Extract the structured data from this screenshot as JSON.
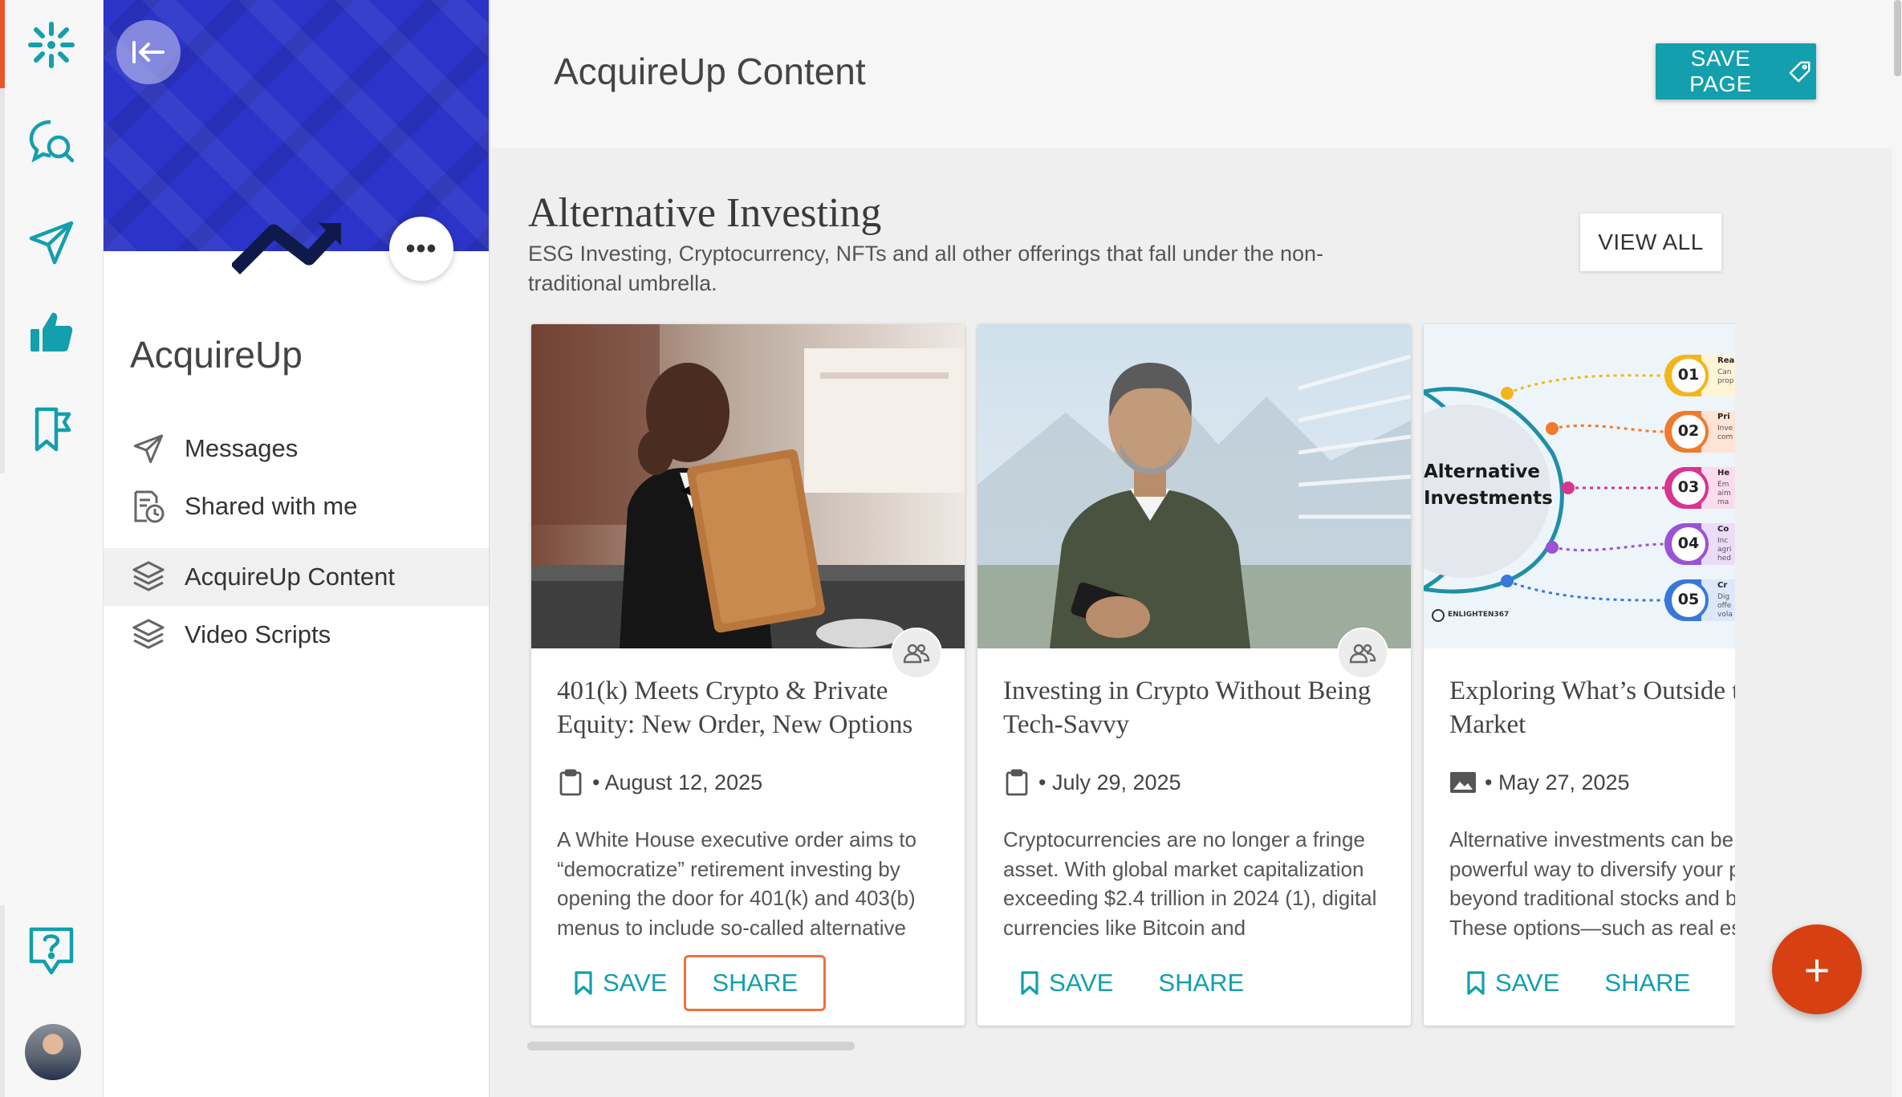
{
  "app": {
    "page_title": "AcquireUp Content",
    "save_page_label": "SAVE PAGE",
    "accent_color": "#139fad",
    "brand_orange": "#e8562a"
  },
  "rail": {
    "icons": [
      "brand-spark-icon",
      "search-chat-icon",
      "paper-plane-icon",
      "thumbs-up-icon",
      "bookmark-flag-icon",
      "help-chat-icon",
      "user-avatar"
    ]
  },
  "panel": {
    "org_name": "AcquireUp",
    "nav": [
      {
        "label": "Messages",
        "icon": "paper-plane-icon"
      },
      {
        "label": "Shared with me",
        "icon": "shared-doc-icon"
      },
      {
        "label": "AcquireUp Content",
        "icon": "layers-icon",
        "active": true
      },
      {
        "label": "Video Scripts",
        "icon": "layers-icon"
      }
    ]
  },
  "section": {
    "title": "Alternative Investing",
    "description": "ESG Investing, Cryptocurrency, NFTs and all other offerings that fall under the non-traditional umbrella.",
    "view_all_label": "VIEW ALL"
  },
  "cards": [
    {
      "title": "401(k) Meets Crypto & Private Equity: New Order, New Options",
      "meta_icon": "clipboard-icon",
      "date": "• August 12, 2025",
      "excerpt": "A White House executive order aims to “democratize” retirement investing by opening the door for 401(k) and 403(b) menus to include so-called alternative",
      "save_label": "SAVE",
      "share_label": "SHARE"
    },
    {
      "title": "Investing in Crypto Without Being Tech-Savvy",
      "meta_icon": "clipboard-icon",
      "date": "• July 29, 2025",
      "excerpt": "Cryptocurrencies are no longer a fringe asset. With global market capitalization exceeding $2.4 trillion in 2024 (1), digital currencies like Bitcoin and",
      "save_label": "SAVE",
      "share_label": "SHARE"
    },
    {
      "title": "Exploring What’s Outside the Stock Market",
      "meta_icon": "image-icon",
      "date": "• May 27, 2025",
      "excerpt": "Alternative investments can be a powerful way to diversify your portfolio beyond traditional stocks and bonds. These options—such as real estate",
      "save_label": "SAVE",
      "share_label": "SHARE",
      "infographic": {
        "center_text": "Alternative Investments",
        "steps": [
          "01",
          "02",
          "03",
          "04",
          "05"
        ],
        "step_headings": [
          "Rea",
          "Pri",
          "He",
          "Co",
          "Cr"
        ],
        "step_text": [
          "Can prop",
          "Inve com",
          "Em aim ma",
          "Inc agri hed",
          "Dig offe vola"
        ],
        "credit": "ENLIGHTEN367",
        "step_colors": [
          "#f2b61c",
          "#f07a2c",
          "#d9348f",
          "#9b52d6",
          "#3a78d8"
        ]
      }
    }
  ],
  "fab_label": "+"
}
